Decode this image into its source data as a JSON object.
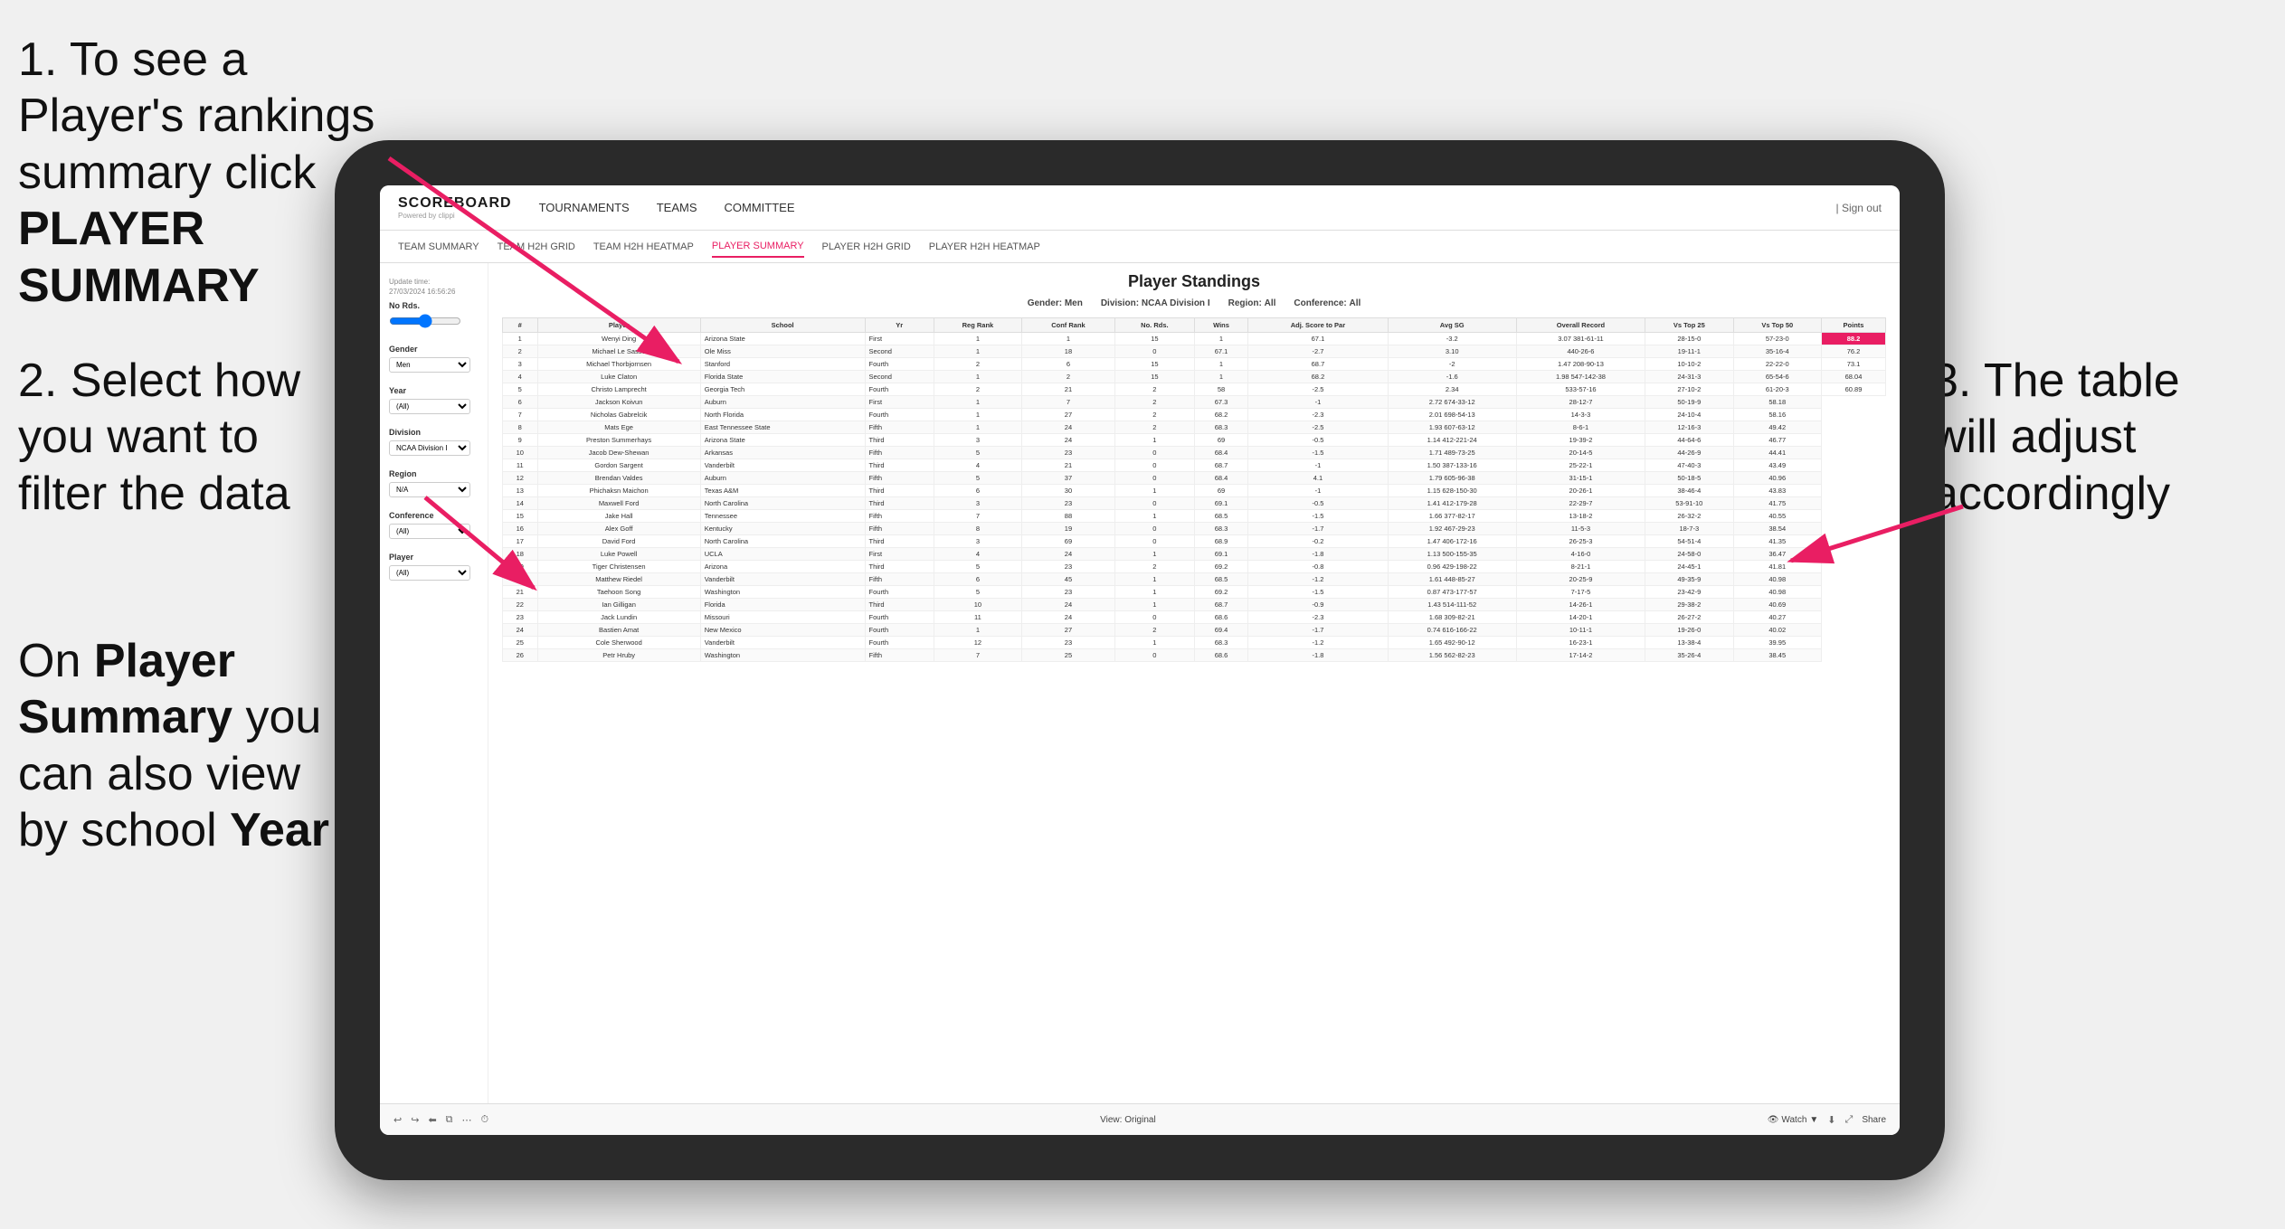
{
  "instructions": {
    "step1": "1. To see a Player's rankings summary click ",
    "step1_bold": "PLAYER SUMMARY",
    "step2_line1": "2. Select how you want to filter the data",
    "step3_right": "3. The table will adjust accordingly",
    "bottom_line1": "On ",
    "bottom_bold": "Player Summary",
    "bottom_line2": " you can also view by school ",
    "bottom_bold2": "Year"
  },
  "nav": {
    "logo": "SCOREBOARD",
    "logo_sub": "Powered by clippi",
    "items": [
      "TOURNAMENTS",
      "TEAMS",
      "COMMITTEE"
    ],
    "right": "Sign out"
  },
  "subnav": {
    "items": [
      "TEAM SUMMARY",
      "TEAM H2H GRID",
      "TEAM H2H HEATMAP",
      "PLAYER SUMMARY",
      "PLAYER H2H GRID",
      "PLAYER H2H HEATMAP"
    ],
    "active": "PLAYER SUMMARY"
  },
  "sidebar": {
    "update_time_label": "Update time:",
    "update_time": "27/03/2024 16:56:26",
    "no_rds_label": "No Rds.",
    "gender_label": "Gender",
    "gender_value": "Men",
    "year_label": "Year",
    "year_value": "(All)",
    "division_label": "Division",
    "division_value": "NCAA Division I",
    "region_label": "Region",
    "region_value": "N/A",
    "conference_label": "Conference",
    "conference_value": "(All)",
    "player_label": "Player",
    "player_value": "(All)"
  },
  "table": {
    "title": "Player Standings",
    "filters": {
      "gender_label": "Gender:",
      "gender_value": "Men",
      "division_label": "Division:",
      "division_value": "NCAA Division I",
      "region_label": "Region:",
      "region_value": "All",
      "conference_label": "Conference:",
      "conference_value": "All"
    },
    "columns": [
      "#",
      "Player",
      "School",
      "Yr",
      "Reg Rank",
      "Conf Rank",
      "No. Rds.",
      "Wins",
      "Adj. Score to Par",
      "Avg SG",
      "Overall Record",
      "Vs Top 25",
      "Vs Top 50",
      "Points"
    ],
    "rows": [
      [
        1,
        "Wenyi Ding",
        "Arizona State",
        "First",
        1,
        1,
        15,
        1,
        67.1,
        -3.2,
        "3.07 381-61-11",
        "28-15-0",
        "57-23-0",
        "88.2"
      ],
      [
        2,
        "Michael Le Sasso",
        "Ole Miss",
        "Second",
        1,
        18,
        0,
        67.1,
        -2.7,
        "3.10",
        "440-26-6",
        "19-11-1",
        "35-16-4",
        "76.2"
      ],
      [
        3,
        "Michael Thorbjornsen",
        "Stanford",
        "Fourth",
        2,
        6,
        15,
        1,
        68.7,
        -2.0,
        "1.47 208-90-13",
        "10-10-2",
        "22-22-0",
        "73.1"
      ],
      [
        4,
        "Luke Claton",
        "Florida State",
        "Second",
        1,
        2,
        15,
        1,
        68.2,
        -1.6,
        "1.98 547-142-38",
        "24-31-3",
        "65-54-6",
        "68.04"
      ],
      [
        5,
        "Christo Lamprecht",
        "Georgia Tech",
        "Fourth",
        2,
        21,
        2,
        58.0,
        -2.5,
        "2.34",
        "533-57-16",
        "27-10-2",
        "61-20-3",
        "60.89"
      ],
      [
        6,
        "Jackson Koivun",
        "Auburn",
        "First",
        1,
        7,
        2,
        67.3,
        -1.0,
        "2.72 674-33-12",
        "28-12-7",
        "50-19-9",
        "58.18"
      ],
      [
        7,
        "Nicholas Gabrelcik",
        "North Florida",
        "Fourth",
        1,
        27,
        2,
        68.2,
        -2.3,
        "2.01 698-54-13",
        "14-3-3",
        "24-10-4",
        "58.16"
      ],
      [
        8,
        "Mats Ege",
        "East Tennessee State",
        "Fifth",
        1,
        24,
        2,
        68.3,
        -2.5,
        "1.93 607-63-12",
        "8-6-1",
        "12-16-3",
        "49.42"
      ],
      [
        9,
        "Preston Summerhays",
        "Arizona State",
        "Third",
        3,
        24,
        1,
        69.0,
        -0.5,
        "1.14 412-221-24",
        "19-39-2",
        "44-64-6",
        "46.77"
      ],
      [
        10,
        "Jacob Dew-Shewan",
        "Arkansas",
        "Fifth",
        5,
        23,
        0,
        68.4,
        -1.5,
        "1.71 489-73-25",
        "20-14-5",
        "44-26-9",
        "44.41"
      ],
      [
        11,
        "Gordon Sargent",
        "Vanderbilt",
        "Third",
        4,
        21,
        0,
        68.7,
        -1.0,
        "1.50 387-133-16",
        "25-22-1",
        "47-40-3",
        "43.49"
      ],
      [
        12,
        "Brendan Valdes",
        "Auburn",
        "Fifth",
        5,
        37,
        0,
        68.4,
        4.1,
        "1.79 605-96-38",
        "31-15-1",
        "50-18-5",
        "40.96"
      ],
      [
        13,
        "Phichaksn Maichon",
        "Texas A&M",
        "Third",
        6,
        30,
        1,
        69.0,
        -1.0,
        "1.15 628-150-30",
        "20-26-1",
        "38-46-4",
        "43.83"
      ],
      [
        14,
        "Maxwell Ford",
        "North Carolina",
        "Third",
        3,
        23,
        0,
        69.1,
        -0.5,
        "1.41 412-179-28",
        "22-29-7",
        "53-91-10",
        "41.75"
      ],
      [
        15,
        "Jake Hall",
        "Tennessee",
        "Fifth",
        7,
        88,
        1,
        68.5,
        -1.5,
        "1.66 377-82-17",
        "13-18-2",
        "26-32-2",
        "40.55"
      ],
      [
        16,
        "Alex Goff",
        "Kentucky",
        "Fifth",
        8,
        19,
        0,
        68.3,
        -1.7,
        "1.92 467-29-23",
        "11-5-3",
        "18-7-3",
        "38.54"
      ],
      [
        17,
        "David Ford",
        "North Carolina",
        "Third",
        3,
        69,
        0,
        68.9,
        -0.2,
        "1.47 406-172-16",
        "26-25-3",
        "54-51-4",
        "41.35"
      ],
      [
        18,
        "Luke Powell",
        "UCLA",
        "First",
        4,
        24,
        1,
        69.1,
        -1.8,
        "1.13 500-155-35",
        "4-16-0",
        "24-58-0",
        "36.47"
      ],
      [
        19,
        "Tiger Christensen",
        "Arizona",
        "Third",
        5,
        23,
        2,
        69.2,
        -0.8,
        "0.96 429-198-22",
        "8-21-1",
        "24-45-1",
        "41.81"
      ],
      [
        20,
        "Matthew Riedel",
        "Vanderbilt",
        "Fifth",
        6,
        45,
        1,
        68.5,
        -1.2,
        "1.61 448-85-27",
        "20-25-9",
        "49-35-9",
        "40.98"
      ],
      [
        21,
        "Taehoon Song",
        "Washington",
        "Fourth",
        5,
        23,
        1,
        69.2,
        -1.5,
        "0.87 473-177-57",
        "7-17-5",
        "23-42-9",
        "40.98"
      ],
      [
        22,
        "Ian Gilligan",
        "Florida",
        "Third",
        10,
        24,
        1,
        68.7,
        -0.9,
        "1.43 514-111-52",
        "14-26-1",
        "29-38-2",
        "40.69"
      ],
      [
        23,
        "Jack Lundin",
        "Missouri",
        "Fourth",
        11,
        24,
        0,
        68.6,
        -2.3,
        "1.68 309-82-21",
        "14-20-1",
        "26-27-2",
        "40.27"
      ],
      [
        24,
        "Bastien Amat",
        "New Mexico",
        "Fourth",
        1,
        27,
        2,
        69.4,
        -1.7,
        "0.74 616-166-22",
        "10-11-1",
        "19-26-0",
        "40.02"
      ],
      [
        25,
        "Cole Sherwood",
        "Vanderbilt",
        "Fourth",
        12,
        23,
        1,
        68.3,
        -1.2,
        "1.65 492-90-12",
        "16-23-1",
        "13-38-4",
        "39.95"
      ],
      [
        26,
        "Petr Hruby",
        "Washington",
        "Fifth",
        7,
        25,
        0,
        68.6,
        -1.8,
        "1.56 562-82-23",
        "17-14-2",
        "35-26-4",
        "38.45"
      ]
    ]
  },
  "toolbar": {
    "view_label": "View: Original",
    "watch_label": "Watch",
    "share_label": "Share"
  }
}
